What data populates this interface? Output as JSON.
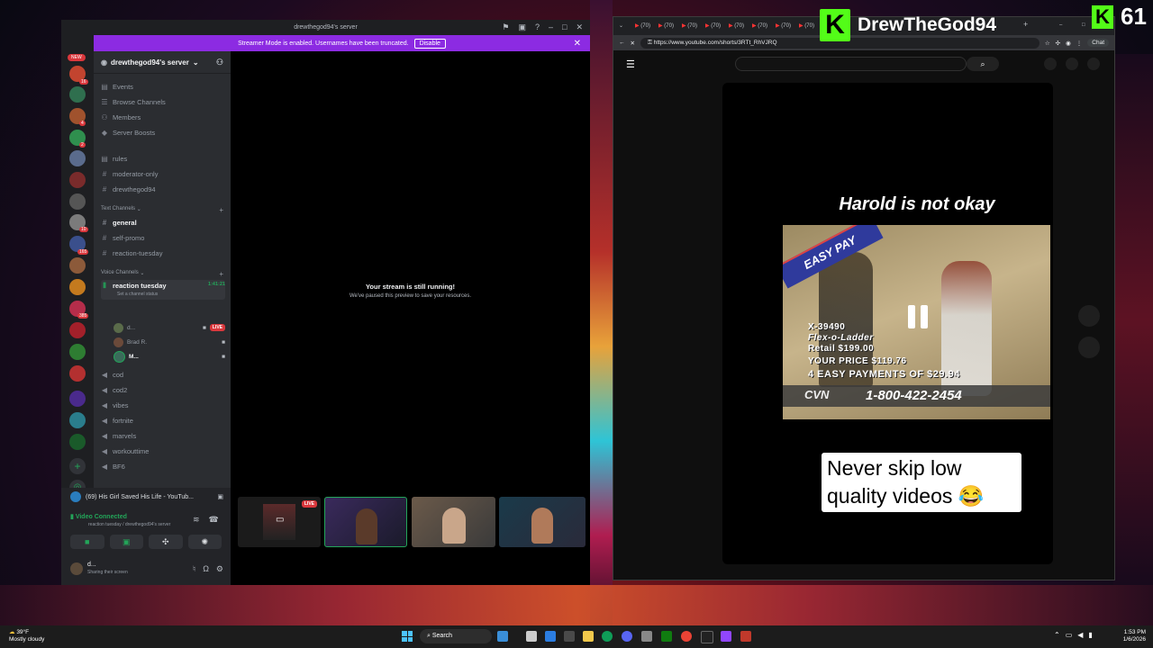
{
  "discord": {
    "window_title": "drewthegod94's server",
    "banner_text": "Streamer Mode is enabled. Usernames have been truncated.",
    "banner_button": "Disable",
    "new_badge": "NEW",
    "guild_badges": [
      "16",
      "4",
      "2",
      "10",
      "165",
      "385"
    ],
    "server_name": "drewthegod94's server",
    "nav_items": [
      {
        "icon": "calendar-icon",
        "label": "Events"
      },
      {
        "icon": "browse-icon",
        "label": "Browse Channels"
      },
      {
        "icon": "members-icon",
        "label": "Members"
      },
      {
        "icon": "boost-icon",
        "label": "Server Boosts"
      }
    ],
    "top_channels": [
      "rules",
      "moderator-only",
      "drewthegod94"
    ],
    "text_category": "Text Channels",
    "text_channels": [
      "general",
      "self-promo",
      "reaction-tuesday"
    ],
    "voice_category": "Voice Channels",
    "active_voice": {
      "name": "reaction tuesday",
      "timer": "1:41:21",
      "status": "Set a channel status"
    },
    "voice_users": [
      {
        "name": "d...",
        "live": "LIVE"
      },
      {
        "name": "Brad R.",
        "live": ""
      },
      {
        "name": "M...",
        "live": ""
      }
    ],
    "voice_channels": [
      "cod",
      "cod2",
      "vibes",
      "fortnite",
      "marvels",
      "workouttime",
      "BF6"
    ],
    "activity": "(69) His Girl Saved His Life - YouTub...",
    "connection_status": "Video Connected",
    "connection_sub": "reaction tuesday / drewthegod94's server",
    "user_name": "d...",
    "user_status": "Sharing their screen",
    "stream_title": "Your stream is still running!",
    "stream_sub": "We've paused this preview to save your resources.",
    "tile_live": "LIVE"
  },
  "browser": {
    "url": "https://www.youtube.com/shorts/3RTt_RhVJRQ",
    "tab_labels": [
      "(70)",
      "(70)",
      "(70)",
      "(70)",
      "(70)",
      "(70)",
      "(70)",
      "(70)"
    ],
    "chat_button": "Chat",
    "short_title": "Harold is not okay",
    "caption": "Never skip low quality videos 😂",
    "video": {
      "banner": "EASY PAY",
      "line1": "X-39490",
      "line2": "Flex-o-Ladder",
      "line3": "Retail $199.00",
      "line4": "YOUR PRICE $119.76",
      "line5": "4 EASY PAYMENTS OF $29.94",
      "phone": "1-800-422-2454",
      "logo": "CVN"
    }
  },
  "overlay": {
    "streamer": "DrewTheGod94",
    "viewer_count": "61",
    "brand_color": "#53fc18"
  },
  "taskbar": {
    "temp": "39°F",
    "weather": "Mostly cloudy",
    "search": "Search",
    "time": "1:53 PM",
    "date": "1/6/2026"
  }
}
